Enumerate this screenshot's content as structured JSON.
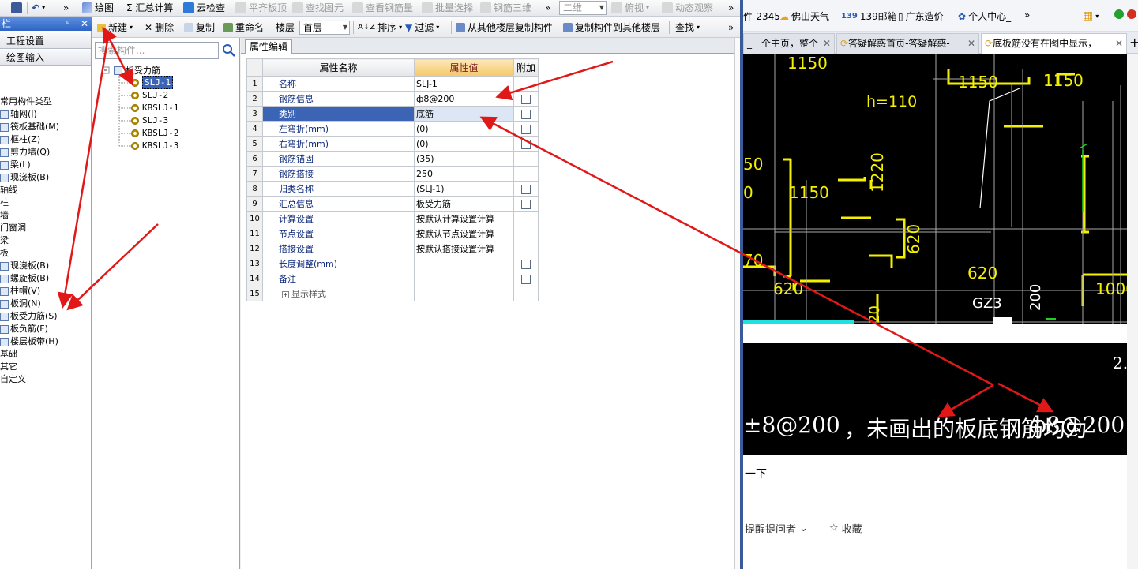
{
  "app": {
    "panel_title": "栏",
    "toolbar1": {
      "draw": "绘图",
      "summary": "Σ 汇总计算",
      "cloud_check": "云检查",
      "align_top": "平齐板顶",
      "find_element": "查找图元",
      "view_rebar": "查看钢筋量",
      "batch_select": "批量选择",
      "rebar_3d": "钢筋三维",
      "view_mode": "二维",
      "view_dir": "俯视",
      "dynamic_view": "动态观察"
    },
    "nav": {
      "project_settings": "工程设置",
      "drawing_input": "绘图输入"
    },
    "tree": [
      "常用构件类型",
      "轴网(J)",
      "筏板基础(M)",
      "框柱(Z)",
      "剪力墙(Q)",
      "梁(L)",
      "现浇板(B)",
      "轴线",
      "柱",
      "墙",
      "门窗洞",
      "梁",
      "板",
      "现浇板(B)",
      "螺旋板(B)",
      "柱帽(V)",
      "板洞(N)",
      "板受力筋(S)",
      "板负筋(F)",
      "楼层板带(H)",
      "基础",
      "其它",
      "自定义"
    ],
    "toolbar2": {
      "new": "新建",
      "delete": "删除",
      "copy": "复制",
      "rename": "重命名",
      "floor_label": "楼层",
      "floor_value": "首层",
      "sort": "排序",
      "filter": "过滤",
      "copy_from_floor": "从其他楼层复制构件",
      "copy_to_floor": "复制构件到其他楼层",
      "find": "查找"
    },
    "search_placeholder": "搜索构件...",
    "component_root": "板受力筋",
    "components": [
      "SLJ-1",
      "SLJ-2",
      "KBSLJ-1",
      "SLJ-3",
      "KBSLJ-2",
      "KBSLJ-3"
    ],
    "tab_label": "属性编辑",
    "grid_headers": {
      "name": "属性名称",
      "value": "属性值",
      "extra": "附加"
    },
    "properties": [
      {
        "n": "1",
        "name": "名称",
        "value": "SLJ-1",
        "chk": false
      },
      {
        "n": "2",
        "name": "钢筋信息",
        "value": "ф8@200",
        "chk": true
      },
      {
        "n": "3",
        "name": "类别",
        "value": "底筋",
        "chk": true
      },
      {
        "n": "4",
        "name": "左弯折(mm)",
        "value": "(0)",
        "chk": true
      },
      {
        "n": "5",
        "name": "右弯折(mm)",
        "value": "(0)",
        "chk": true
      },
      {
        "n": "6",
        "name": "钢筋锚固",
        "value": "(35)",
        "chk": false
      },
      {
        "n": "7",
        "name": "钢筋搭接",
        "value": "250",
        "chk": false
      },
      {
        "n": "8",
        "name": "归类名称",
        "value": "(SLJ-1)",
        "chk": true
      },
      {
        "n": "9",
        "name": "汇总信息",
        "value": "板受力筋",
        "chk": true
      },
      {
        "n": "10",
        "name": "计算设置",
        "value": "按默认计算设置计算",
        "chk": false
      },
      {
        "n": "11",
        "name": "节点设置",
        "value": "按默认节点设置计算",
        "chk": false
      },
      {
        "n": "12",
        "name": "搭接设置",
        "value": "按默认搭接设置计算",
        "chk": false
      },
      {
        "n": "13",
        "name": "长度调整(mm)",
        "value": "",
        "chk": true
      },
      {
        "n": "14",
        "name": "备注",
        "value": "",
        "chk": true
      },
      {
        "n": "15",
        "name": "显示样式",
        "value": "",
        "chk": false
      }
    ]
  },
  "browser": {
    "bookmarks": [
      "件-2345",
      "佛山天气",
      "139邮箱",
      "广东造价",
      "个人中心_"
    ],
    "tabs": [
      "_一个主页，整个",
      "答疑解惑首页-答疑解惑-",
      "底板筋没有在图中显示，"
    ],
    "cad_labels": {
      "t1150a": "1150",
      "t1150b": "1150",
      "t1150c": "1150",
      "t1150d": "1150",
      "h110": "h=110",
      "t50": "50",
      "t0": "0",
      "t1220": "1220",
      "t620a": "620",
      "t620b": "620",
      "t620c": "620",
      "t70": "70",
      "t1000": "1000",
      "gz3": "GZ3",
      "t200": "200",
      "t20": "20"
    },
    "cad_note": {
      "left": "±8@200",
      "middle": "，未画出的板底钢筋均为",
      "right": "ф8@200",
      "corner": "2."
    },
    "below_text": "一下",
    "remind": "提醒提问者",
    "favorite": "收藏"
  }
}
